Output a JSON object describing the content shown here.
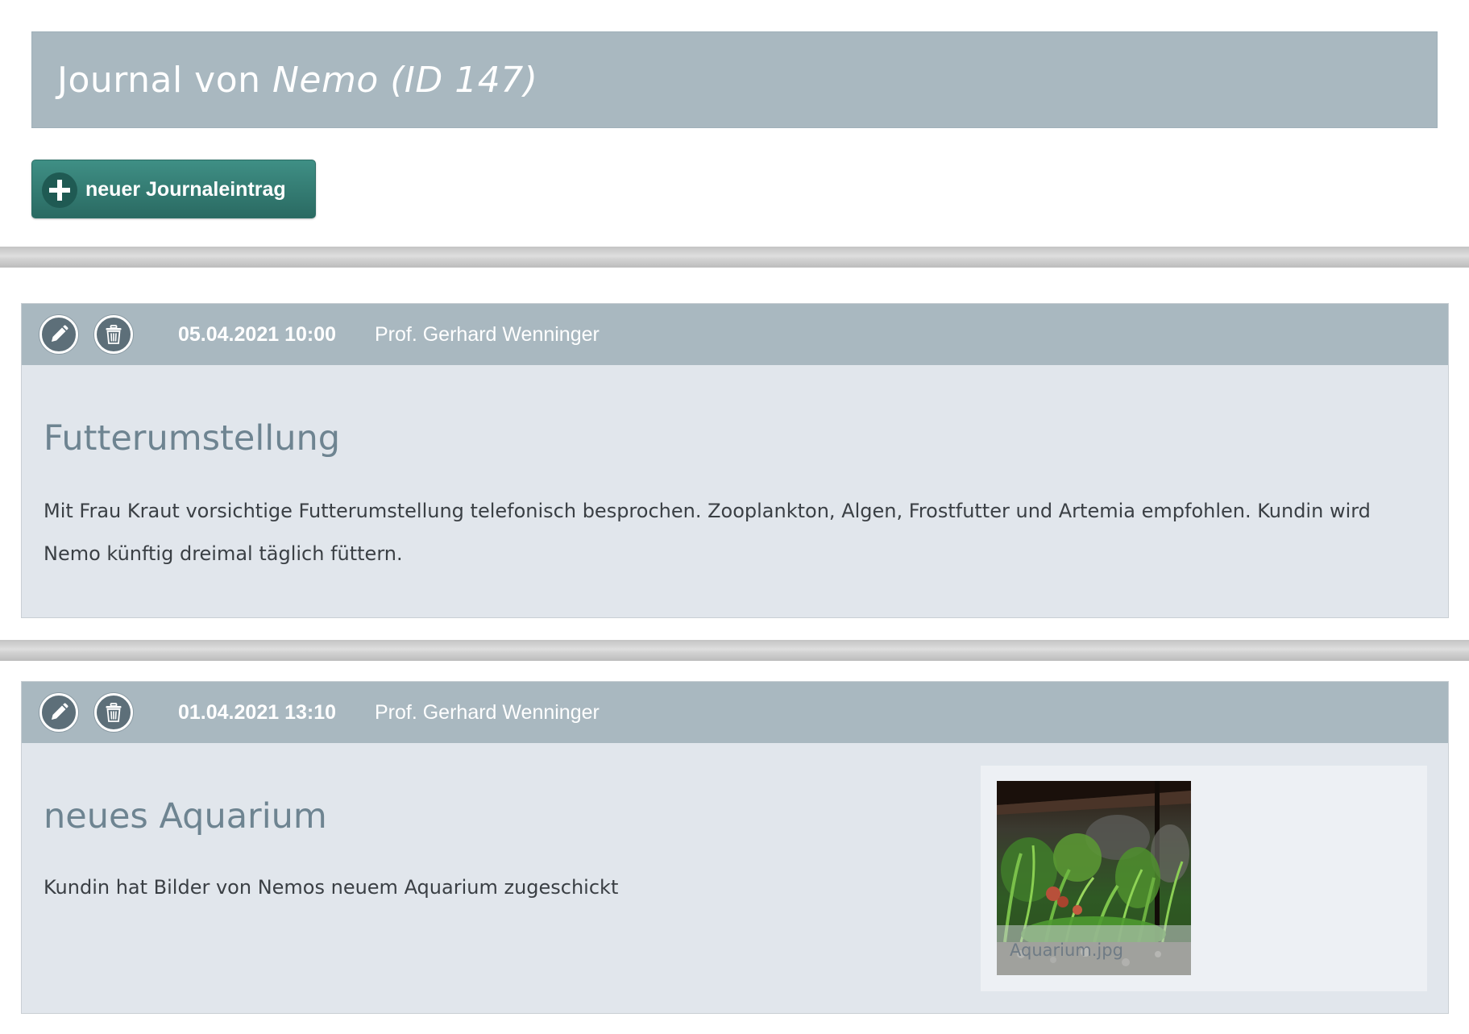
{
  "header": {
    "title_prefix": "Journal von",
    "title_name": "Nemo (ID 147)"
  },
  "toolbar": {
    "new_entry_label": "neuer Journaleintrag"
  },
  "entries": [
    {
      "date": "05.04.2021 10:00",
      "author": "Prof. Gerhard Wenninger",
      "title": "Futterumstellung",
      "text": "Mit Frau Kraut vorsichtige Futterumstellung telefonisch besprochen. Zooplankton, Algen, Frostfutter und Artemia empfohlen. Kundin wird Nemo künftig dreimal täglich füttern."
    },
    {
      "date": "01.04.2021 13:10",
      "author": "Prof. Gerhard Wenninger",
      "title": "neues Aquarium",
      "text": "Kundin hat Bilder von Nemos neuem Aquarium zugeschickt",
      "attachment": {
        "filename": "Aquarium.jpg"
      }
    }
  ],
  "icons": {
    "edit": "pencil-icon",
    "delete": "trash-icon",
    "add": "plus-icon"
  },
  "colors": {
    "header_bg": "#a9b8c0",
    "button_bg": "#2f7a71",
    "entry_bg": "#e1e6ec",
    "title_color": "#6e8491"
  }
}
